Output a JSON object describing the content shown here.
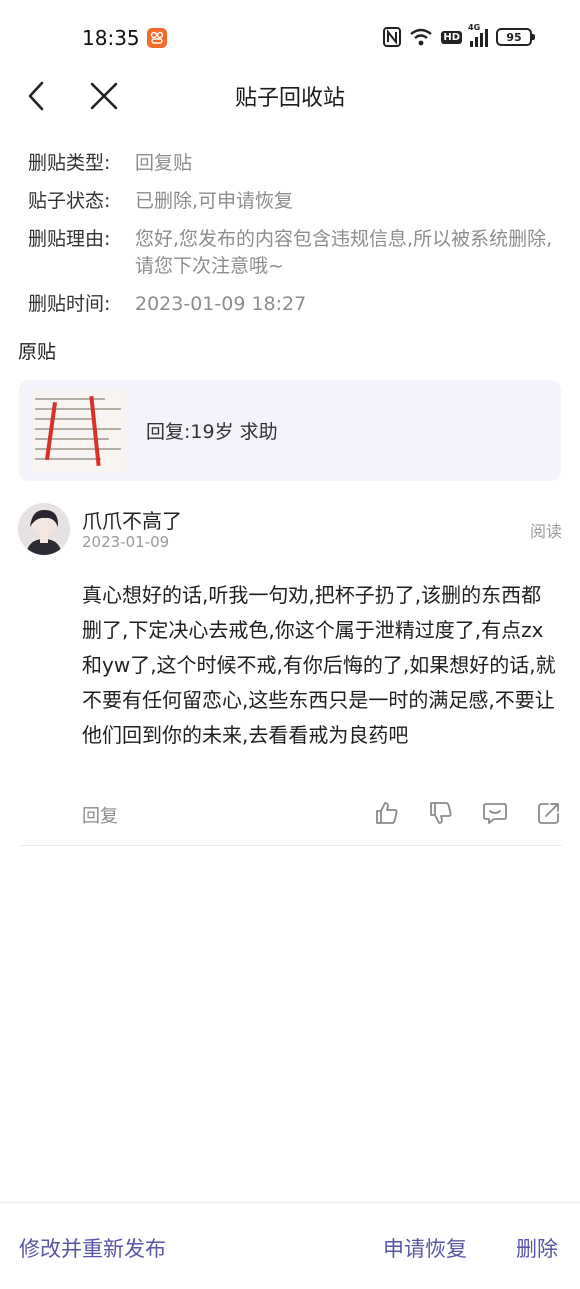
{
  "status_bar": {
    "time": "18:35",
    "notification_icon": "app-notification-icon",
    "nfc_icon": "nfc-icon",
    "wifi_icon": "wifi-icon",
    "hd_label": "HD",
    "network_label": "4G",
    "signal_icon": "signal-icon",
    "battery": "95"
  },
  "header": {
    "back_icon": "chevron-left-icon",
    "close_icon": "close-icon",
    "title": "贴子回收站"
  },
  "info": {
    "type_label": "删贴类型:",
    "type_value": "回复贴",
    "status_label": "贴子状态:",
    "status_value": "已删除,可申请恢复",
    "reason_label": "删贴理由:",
    "reason_value": "您好,您发布的内容包含违规信息,所以被系统删除,请您下次注意哦~",
    "time_label": "删贴时间:",
    "time_value": "2023-01-09 18:27"
  },
  "original_post": {
    "section_title": "原贴",
    "title": "回复:19岁 求助"
  },
  "comment": {
    "username": "爪爪不高了",
    "date": "2023-01-09",
    "read_label": "阅读",
    "body": " 真心想好的话,听我一句劝,把杯子扔了,该删的东西都删了,下定决心去戒色,你这个属于泄精过度了,有点zx和yw了,这个时候不戒,有你后悔的了,如果想好的话,就不要有任何留恋心,这些东西只是一时的满足感,不要让他们回到你的未来,去看看戒为良药吧",
    "reply_label": "回复",
    "action_icons": [
      "thumbs-up-icon",
      "thumbs-down-icon",
      "comment-icon",
      "share-icon"
    ]
  },
  "bottom_bar": {
    "edit_label": "修改并重新发布",
    "restore_label": "申请恢复",
    "delete_label": "删除"
  },
  "colors": {
    "accent": "#5b55a6",
    "muted_text": "#8d8d8d",
    "card_background": "#f4f3fb"
  }
}
